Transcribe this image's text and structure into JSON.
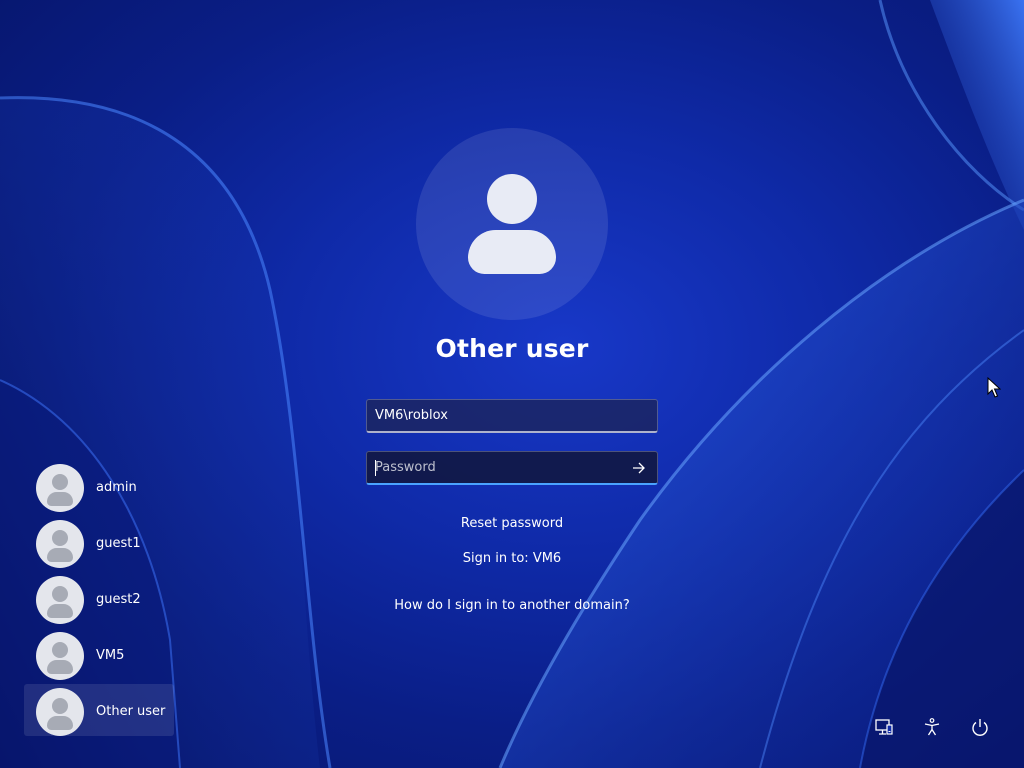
{
  "screen": {
    "title": "Other user"
  },
  "form": {
    "username_value": "VM6\\roblox",
    "password_placeholder": "Password",
    "reset_password": "Reset password",
    "sign_in_to": "Sign in to: VM6",
    "domain_help": "How do I sign in to another domain?"
  },
  "users": [
    {
      "name": "admin",
      "selected": false
    },
    {
      "name": "guest1",
      "selected": false
    },
    {
      "name": "guest2",
      "selected": false
    },
    {
      "name": "VM5",
      "selected": false
    },
    {
      "name": "Other user",
      "selected": true
    }
  ],
  "tray": {
    "icons": [
      "network-icon",
      "accessibility-icon",
      "power-icon"
    ]
  },
  "colors": {
    "background": "#0f2aa8",
    "focus_underline": "#4aa3ff"
  }
}
